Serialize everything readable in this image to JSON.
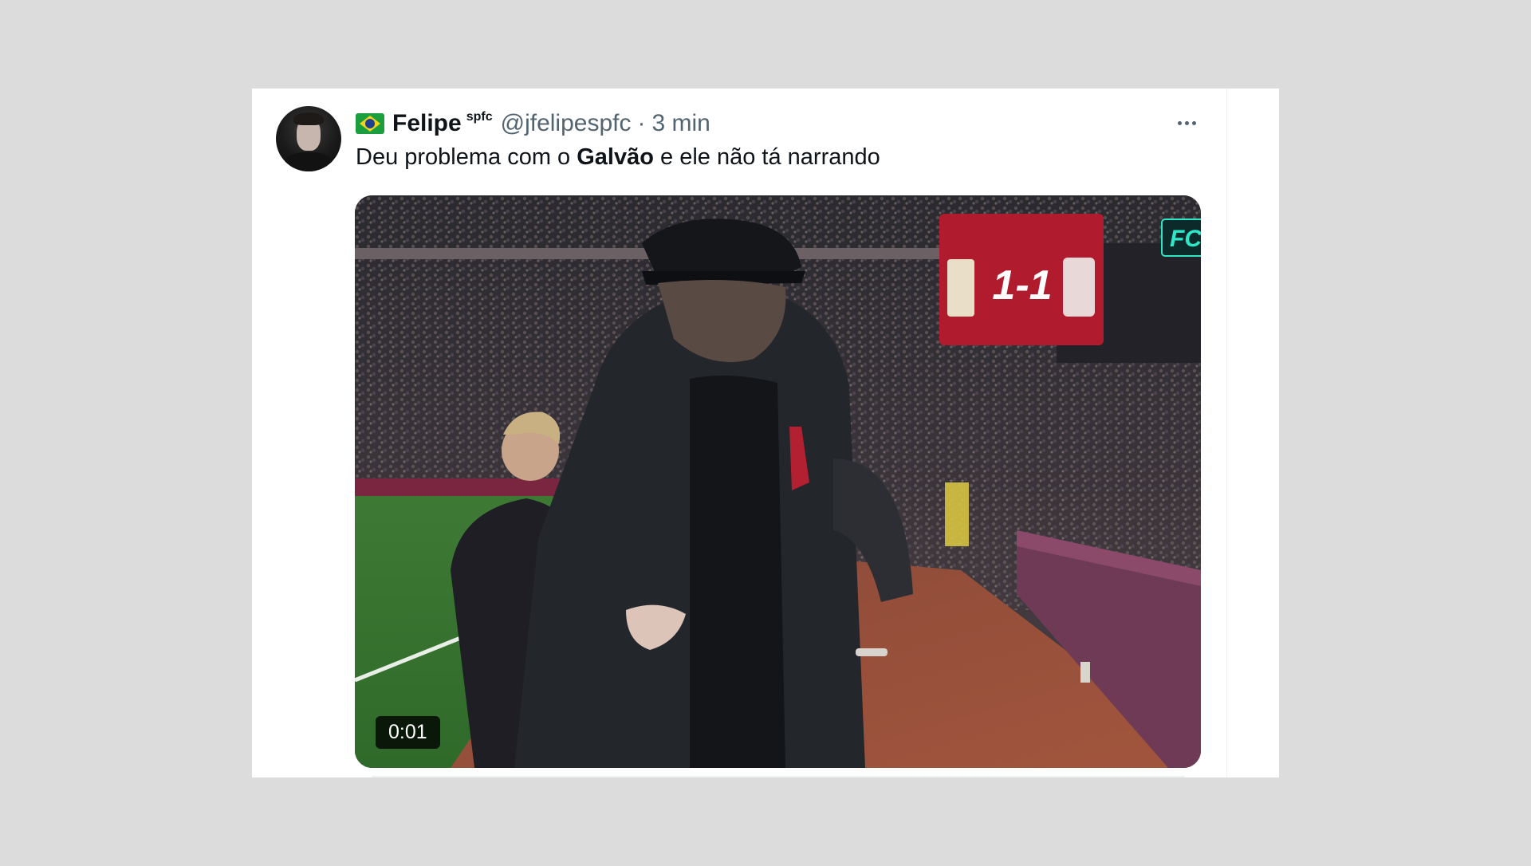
{
  "tweet": {
    "author_name": "Felipe",
    "author_tag": "spfc",
    "handle": "@jfelipespfc",
    "separator": "·",
    "time": "3 min",
    "text_before": "Deu problema com o ",
    "text_bold": "Galvão",
    "text_after": " e ele não tá narrando"
  },
  "media": {
    "scoreboard_score": "1-1",
    "channel_logo": "FC",
    "duration": "0:01"
  },
  "icons": {
    "flag": "brazil-flag-icon",
    "more": "more-horizontal-icon"
  },
  "colors": {
    "background": "#dcdcdc",
    "card": "#ffffff",
    "text": "#0f1419",
    "secondary_text": "#536471",
    "scoreboard": "#b01b2e",
    "channel_accent": "#2ee6c8"
  }
}
